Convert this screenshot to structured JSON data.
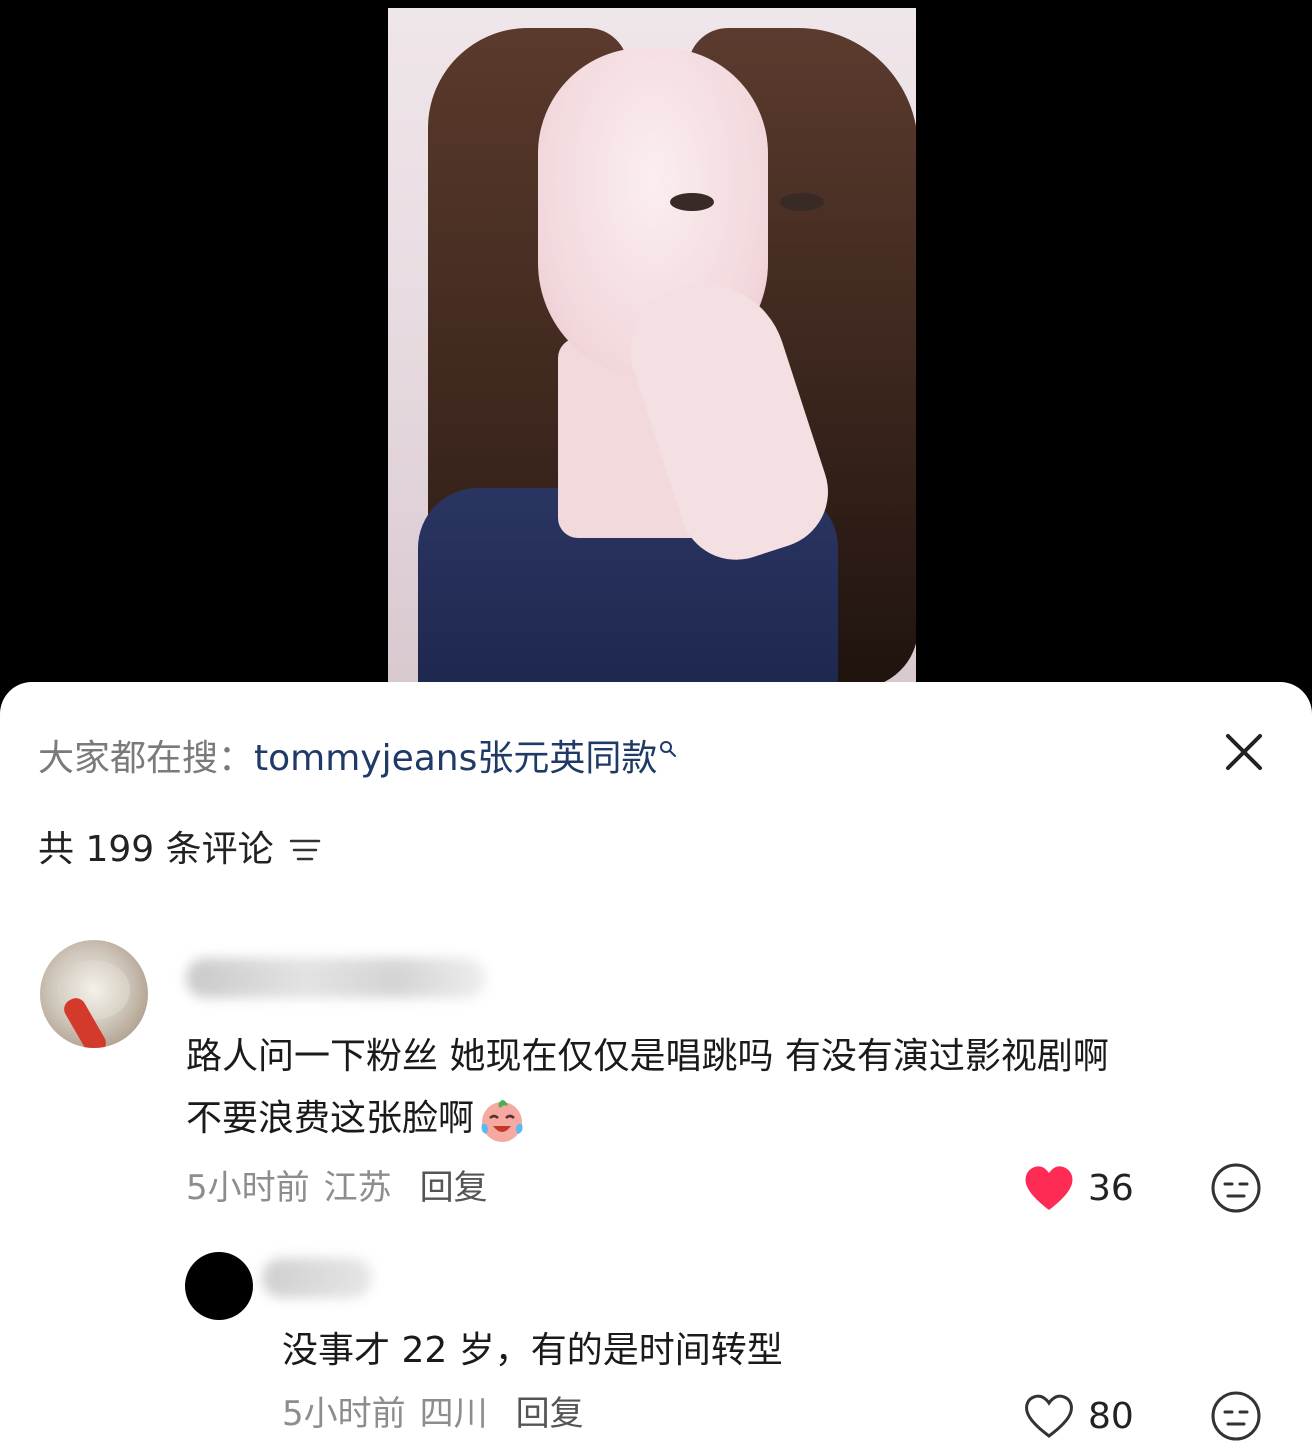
{
  "search_bar": {
    "prefix": "大家都在搜：",
    "term": "tommyjeans张元英同款"
  },
  "comments_header": {
    "count_text": "共 199 条评论"
  },
  "comments": [
    {
      "text_line1": "路人问一下粉丝 她现在仅仅是唱跳吗 有没有演过影视剧啊",
      "text_line2": "不要浪费这张脸啊",
      "time": "5小时前",
      "location": "江苏",
      "reply_label": "回复",
      "likes": "36",
      "liked": true,
      "emoji": "crying-laughing-face-icon"
    },
    {
      "text": "没事才 22 岁，有的是时间转型",
      "time": "5小时前",
      "location": "四川",
      "reply_label": "回复",
      "likes": "80",
      "liked": false
    }
  ],
  "colors": {
    "like_red": "#fe2c55",
    "search_term": "#1f3a66"
  }
}
